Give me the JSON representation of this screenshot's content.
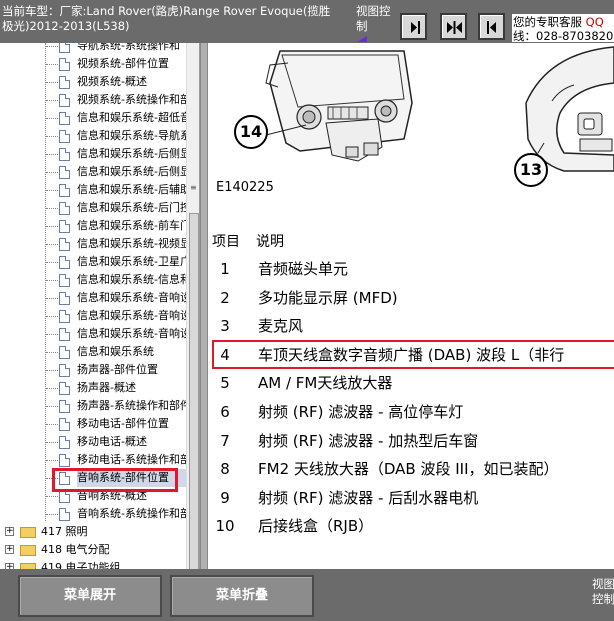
{
  "header": {
    "vehicle_line1": "当前车型：厂家:Land Rover(路虎)Range Rover Evoque(揽胜",
    "vehicle_line2": "极光)2012-2013(L538)",
    "view_control_label": "视图控制",
    "support_text": "您的专职客服",
    "support_qq": "QQ",
    "support_phone": "线：028-8703820"
  },
  "nav_buttons": [
    {
      "name": "collapse-left",
      "icon": "arrow-right-bar"
    },
    {
      "name": "center",
      "icon": "arrows-inward"
    },
    {
      "name": "expand-left",
      "icon": "arrow-left-bar"
    }
  ],
  "tree": {
    "items": [
      "导航系统-系统操作和",
      "视频系统-部件位置",
      "视频系统-概述",
      "视频系统-系统操作和部",
      "信息和娱乐系统-超低音",
      "信息和娱乐系统-导航系",
      "信息和娱乐系统-后侧显",
      "信息和娱乐系统-后侧显",
      "信息和娱乐系统-后辅助",
      "信息和娱乐系统-后门控",
      "信息和娱乐系统-前车门",
      "信息和娱乐系统-视频显",
      "信息和娱乐系统-卫星广",
      "信息和娱乐系统-信息和",
      "信息和娱乐系统-音响设",
      "信息和娱乐系统-音响设",
      "信息和娱乐系统-音响设",
      "信息和娱乐系统",
      "扬声器-部件位置",
      "扬声器-概述",
      "扬声器-系统操作和部件",
      "移动电话-部件位置",
      "移动电话-概述",
      "移动电话-系统操作和部",
      "音响系统-部件位置",
      "音响系统-概述",
      "音响系统-系统操作和部"
    ],
    "selected_index": 24,
    "folders": [
      "417 照明",
      "418 电气分配",
      "419 电子功能组"
    ]
  },
  "figure": {
    "id": "E140225",
    "callouts": [
      "14",
      "13"
    ]
  },
  "legend": {
    "col_item": "项目",
    "col_desc": "说明",
    "rows": [
      {
        "num": "1",
        "desc": "音频磁头单元"
      },
      {
        "num": "2",
        "desc": "多功能显示屏 (MFD)"
      },
      {
        "num": "3",
        "desc": "麦克风"
      },
      {
        "num": "4",
        "desc": "车顶天线盒数字音频广播 (DAB) 波段 L（非行"
      },
      {
        "num": "5",
        "desc": "AM / FM天线放大器"
      },
      {
        "num": "6",
        "desc": "射频 (RF) 滤波器 - 高位停车灯"
      },
      {
        "num": "7",
        "desc": "射频 (RF) 滤波器 - 加热型后车窗"
      },
      {
        "num": "8",
        "desc": "FM2 天线放大器（DAB 波段 III，如已装配）"
      },
      {
        "num": "9",
        "desc": "射频 (RF) 滤波器 - 后刮水器电机"
      },
      {
        "num": "10",
        "desc": "后接线盒（RJB）"
      }
    ],
    "highlighted_index": 3
  },
  "footer": {
    "expand_label": "菜单展开",
    "collapse_label": "菜单折叠",
    "view_control_label": "视图控制"
  },
  "colors": {
    "highlight_red": "#e0182c",
    "toolbar_gray": "#6b6b6b",
    "qq_red": "#cc0000"
  }
}
